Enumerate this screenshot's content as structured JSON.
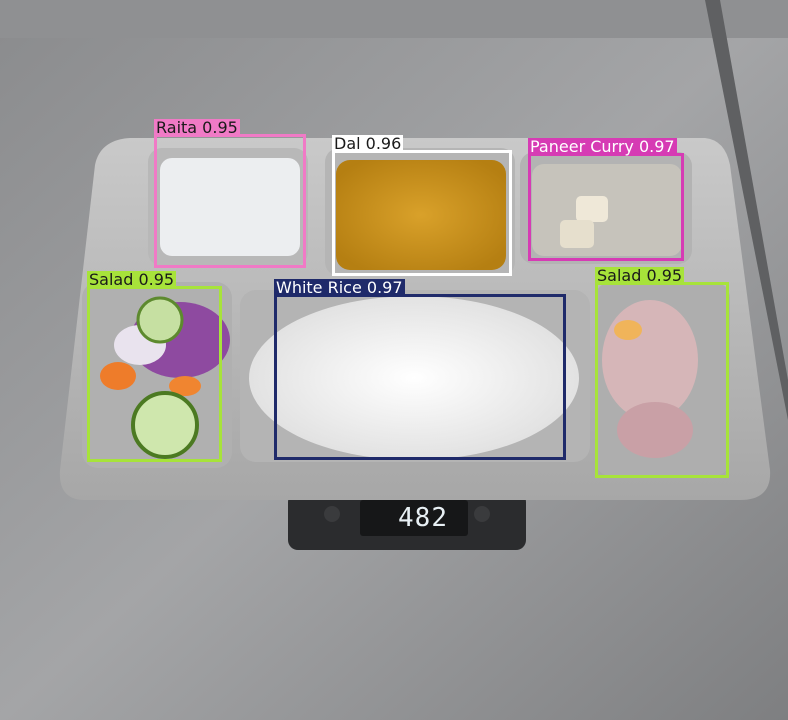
{
  "scale": {
    "reading": "482"
  },
  "detections": [
    {
      "label": "Raita 0.95",
      "color": "#f07ac6",
      "text_color": "#1a1a1a"
    },
    {
      "label": "Dal 0.96",
      "color": "#ffffff",
      "text_color": "#1a1a1a"
    },
    {
      "label": "Paneer Curry 0.97",
      "color": "#d63bb4",
      "text_color": "#ffffff"
    },
    {
      "label": "Salad 0.95",
      "color": "#a7e33a",
      "text_color": "#1a1a1a"
    },
    {
      "label": "White Rice 0.97",
      "color": "#1f2a6a",
      "text_color": "#ffffff"
    },
    {
      "label": "Salad 0.95",
      "color": "#a7e33a",
      "text_color": "#1a1a1a"
    }
  ]
}
